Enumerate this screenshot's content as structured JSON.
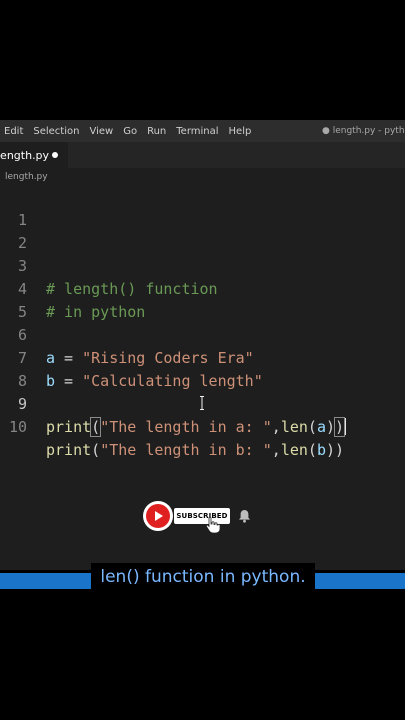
{
  "menubar": {
    "items": [
      "Edit",
      "Selection",
      "View",
      "Go",
      "Run",
      "Terminal",
      "Help"
    ],
    "window_title": "● length.py - python"
  },
  "tab": {
    "label": "length.py"
  },
  "breadcrumb": "length.py",
  "editor": {
    "line_numbers": [
      "1",
      "2",
      "3",
      "4",
      "5",
      "6",
      "7",
      "8",
      "9",
      "10"
    ],
    "line3": "# length() function",
    "line4": "# in python",
    "line6": {
      "var": "a",
      "op": " = ",
      "str": "\"Rising Coders Era\""
    },
    "line7": {
      "var": "b",
      "op": " = ",
      "str": "\"Calculating length\""
    },
    "line9": {
      "fn": "print",
      "open": "(",
      "str": "\"The length in a: \"",
      "comma": ",",
      "fn2": "len",
      "open2": "(",
      "arg": "a",
      "close2": ")",
      "close": ")"
    },
    "line10": {
      "fn": "print",
      "open": "(",
      "str": "\"The length in b: \"",
      "comma": ",",
      "fn2": "len",
      "open2": "(",
      "arg": "b",
      "close2": ")",
      "close": ")"
    }
  },
  "overlay": {
    "subscribed_label": "SUBSCRIBED",
    "caption": "len() function in python."
  },
  "colors": {
    "editor_bg": "#1e1e1e",
    "comment": "#6a9955",
    "string": "#ce9178",
    "variable": "#9cdcfe",
    "function": "#dcdcaa",
    "caption_bar": "#1a74c9",
    "youtube_red": "#e02020"
  },
  "icons": {
    "youtube": "youtube-icon",
    "bell": "bell-icon",
    "hand": "hand-pointer-icon",
    "text_cursor": "text-cursor-icon",
    "modified_dot": "modified-dot-icon"
  }
}
